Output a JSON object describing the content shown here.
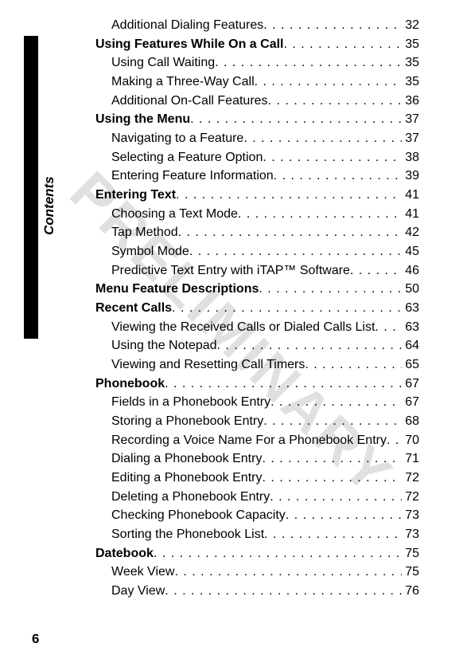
{
  "sidebar_label": "Contents",
  "watermark": "PRELIMINARY",
  "page_number": "6",
  "toc": [
    {
      "level": "subsection",
      "title": "Additional Dialing Features",
      "page": "32"
    },
    {
      "level": "section",
      "title": "Using Features While On a Call",
      "page": "35"
    },
    {
      "level": "subsection",
      "title": "Using Call Waiting",
      "page": "35"
    },
    {
      "level": "subsection",
      "title": "Making a Three-Way Call",
      "page": "35"
    },
    {
      "level": "subsection",
      "title": "Additional On-Call Features",
      "page": "36"
    },
    {
      "level": "section",
      "title": "Using the Menu",
      "page": "37"
    },
    {
      "level": "subsection",
      "title": "Navigating to a Feature",
      "page": "37"
    },
    {
      "level": "subsection",
      "title": "Selecting a Feature Option",
      "page": "38"
    },
    {
      "level": "subsection",
      "title": "Entering Feature Information",
      "page": "39"
    },
    {
      "level": "section",
      "title": "Entering Text",
      "page": "41"
    },
    {
      "level": "subsection",
      "title": "Choosing a Text Mode",
      "page": "41"
    },
    {
      "level": "subsection",
      "title": "Tap Method",
      "page": "42"
    },
    {
      "level": "subsection",
      "title": "Symbol Mode",
      "page": "45"
    },
    {
      "level": "subsection",
      "title": "Predictive Text Entry with iTAP™ Software",
      "page": "46"
    },
    {
      "level": "section",
      "title": "Menu Feature Descriptions",
      "page": "50"
    },
    {
      "level": "section",
      "title": "Recent Calls",
      "page": "63"
    },
    {
      "level": "subsection",
      "title": "Viewing the Received Calls or Dialed Calls List",
      "page": "63"
    },
    {
      "level": "subsection",
      "title": "Using the Notepad",
      "page": "64"
    },
    {
      "level": "subsection",
      "title": "Viewing and Resetting Call Timers",
      "page": "65"
    },
    {
      "level": "section",
      "title": "Phonebook",
      "page": "67"
    },
    {
      "level": "subsection",
      "title": "Fields in a Phonebook Entry",
      "page": "67"
    },
    {
      "level": "subsection",
      "title": "Storing a Phonebook Entry",
      "page": "68"
    },
    {
      "level": "subsection",
      "title": "Recording a Voice Name For a Phonebook Entry",
      "page": "70"
    },
    {
      "level": "subsection",
      "title": "Dialing a Phonebook Entry",
      "page": "71"
    },
    {
      "level": "subsection",
      "title": "Editing a Phonebook Entry",
      "page": "72"
    },
    {
      "level": "subsection",
      "title": "Deleting a Phonebook Entry",
      "page": "72"
    },
    {
      "level": "subsection",
      "title": "Checking Phonebook Capacity",
      "page": "73"
    },
    {
      "level": "subsection",
      "title": "Sorting the Phonebook List",
      "page": "73"
    },
    {
      "level": "section",
      "title": "Datebook",
      "page": "75"
    },
    {
      "level": "subsection",
      "title": "Week View",
      "page": "75"
    },
    {
      "level": "subsection",
      "title": "Day View",
      "page": "76"
    }
  ]
}
